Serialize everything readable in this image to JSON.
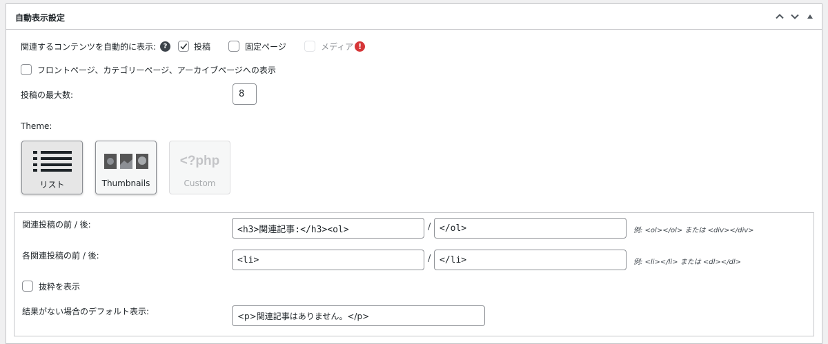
{
  "panel": {
    "title": "自動表示設定",
    "move_up_label": "上へ移動",
    "move_down_label": "下へ移動",
    "toggle_label": "パネルを切り替え"
  },
  "display": {
    "label": "関連するコンテンツを自動的に表示:",
    "help": "?",
    "post_types": [
      {
        "label": "投稿",
        "checked": true,
        "disabled": false
      },
      {
        "label": "固定ページ",
        "checked": false,
        "disabled": false
      },
      {
        "label": "メディア",
        "checked": false,
        "disabled": true
      }
    ],
    "warning": "!"
  },
  "archives": {
    "label": "フロントページ、カテゴリーページ、アーカイブページへの表示",
    "checked": false
  },
  "max_posts": {
    "label": "投稿の最大数:",
    "value": "8"
  },
  "theme": {
    "label": "Theme:",
    "options": [
      {
        "label": "リスト",
        "icon": "list-icon",
        "state": "selected"
      },
      {
        "label": "Thumbnails",
        "icon": "thumbnails-icon",
        "state": "normal"
      },
      {
        "label": "Custom",
        "icon_text": "<?php",
        "state": "disabled"
      }
    ]
  },
  "advanced": {
    "before_after": {
      "label": "関連投稿の前 / 後:",
      "before": "<h3>関連記事:</h3><ol>",
      "after": "</ol>",
      "example": "例: <ol></ol> または <div></div>"
    },
    "item_before_after": {
      "label": "各関連投稿の前 / 後:",
      "before": "<li>",
      "after": "</li>",
      "example": "例: <li></li> または <dl></dl>"
    },
    "excerpt": {
      "label": "抜粋を表示",
      "checked": false
    },
    "no_results": {
      "label": "結果がない場合のデフォルト表示:",
      "value": "<p>関連記事はありません。</p>"
    },
    "separator": "/"
  },
  "colors": {
    "border": "#c3c4c7",
    "warning": "#d63638",
    "text": "#1d2327"
  }
}
